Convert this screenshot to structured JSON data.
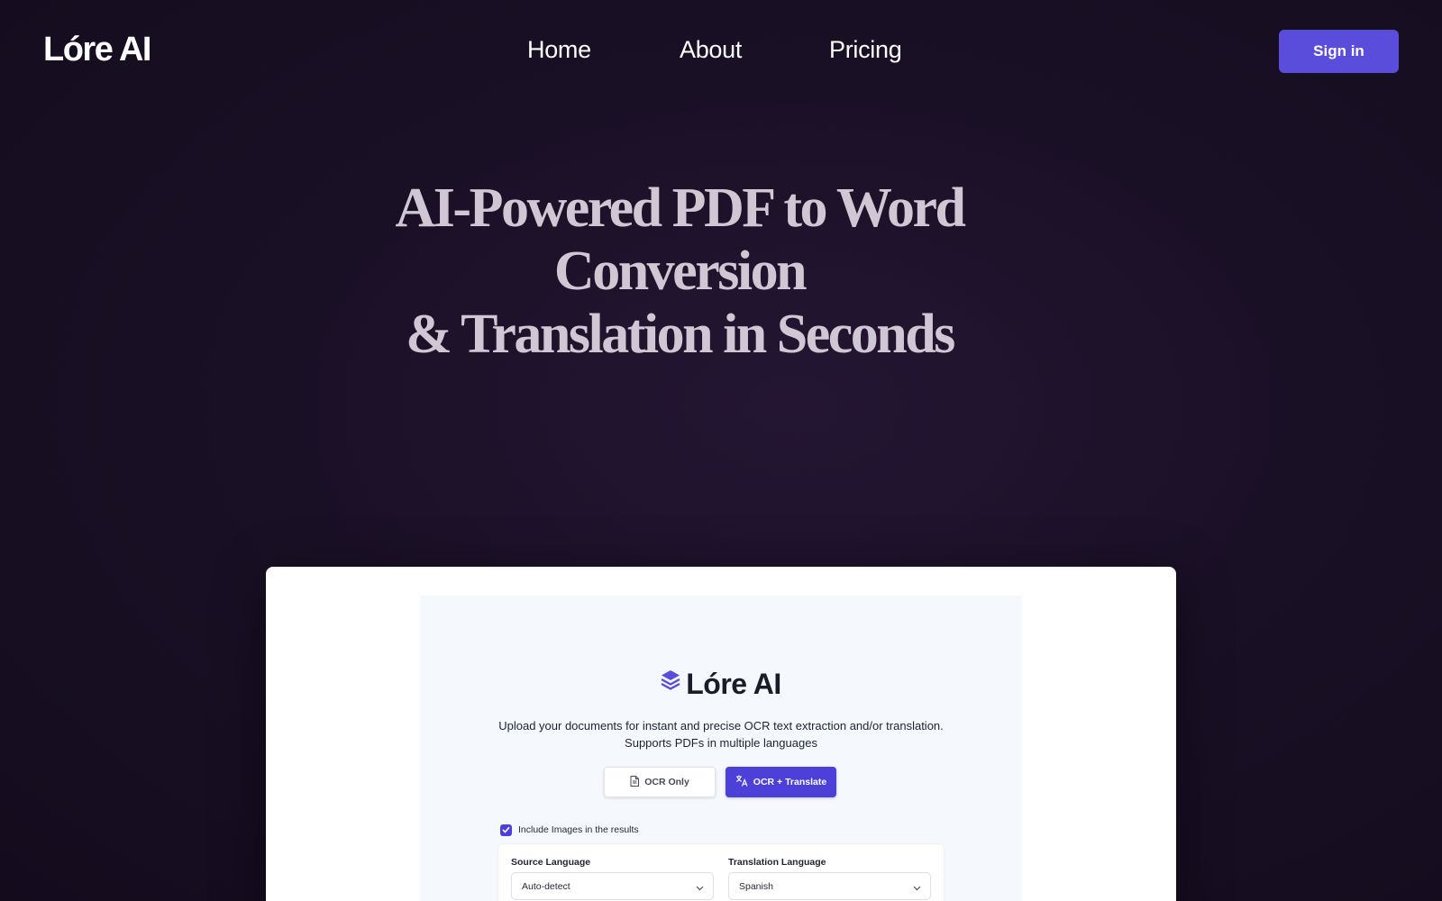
{
  "nav": {
    "logo": "Lóre AI",
    "links": [
      {
        "label": "Home"
      },
      {
        "label": "About"
      },
      {
        "label": "Pricing"
      }
    ],
    "signin_label": "Sign in"
  },
  "hero": {
    "title_line1": "AI-Powered PDF to Word Conversion",
    "title_line2": "& Translation in Seconds"
  },
  "app": {
    "title": "Lóre AI",
    "description_line1": "Upload your documents for instant and precise OCR text extraction and/or translation.",
    "description_line2": "Supports PDFs in multiple languages",
    "modes": {
      "ocr_only_label": "OCR Only",
      "ocr_translate_label": "OCR + Translate",
      "selected": "OCR + Translate"
    },
    "include_images_label": "Include Images in the results",
    "include_images_checked": true,
    "source_language_label": "Source Language",
    "source_language_value": "Auto-detect",
    "translation_language_label": "Translation Language",
    "translation_language_value": "Spanish"
  },
  "colors": {
    "accent": "#5b4ddb",
    "accent_dark": "#4c40d9",
    "background": "#1a1026",
    "hero_text": "#cfc7d3"
  },
  "icons": {
    "logo_icon": "layers-icon",
    "ocr_icon": "document-icon",
    "translate_icon": "translate-icon",
    "checkbox_icon": "check-icon",
    "select_icon": "chevron-down-icon"
  }
}
